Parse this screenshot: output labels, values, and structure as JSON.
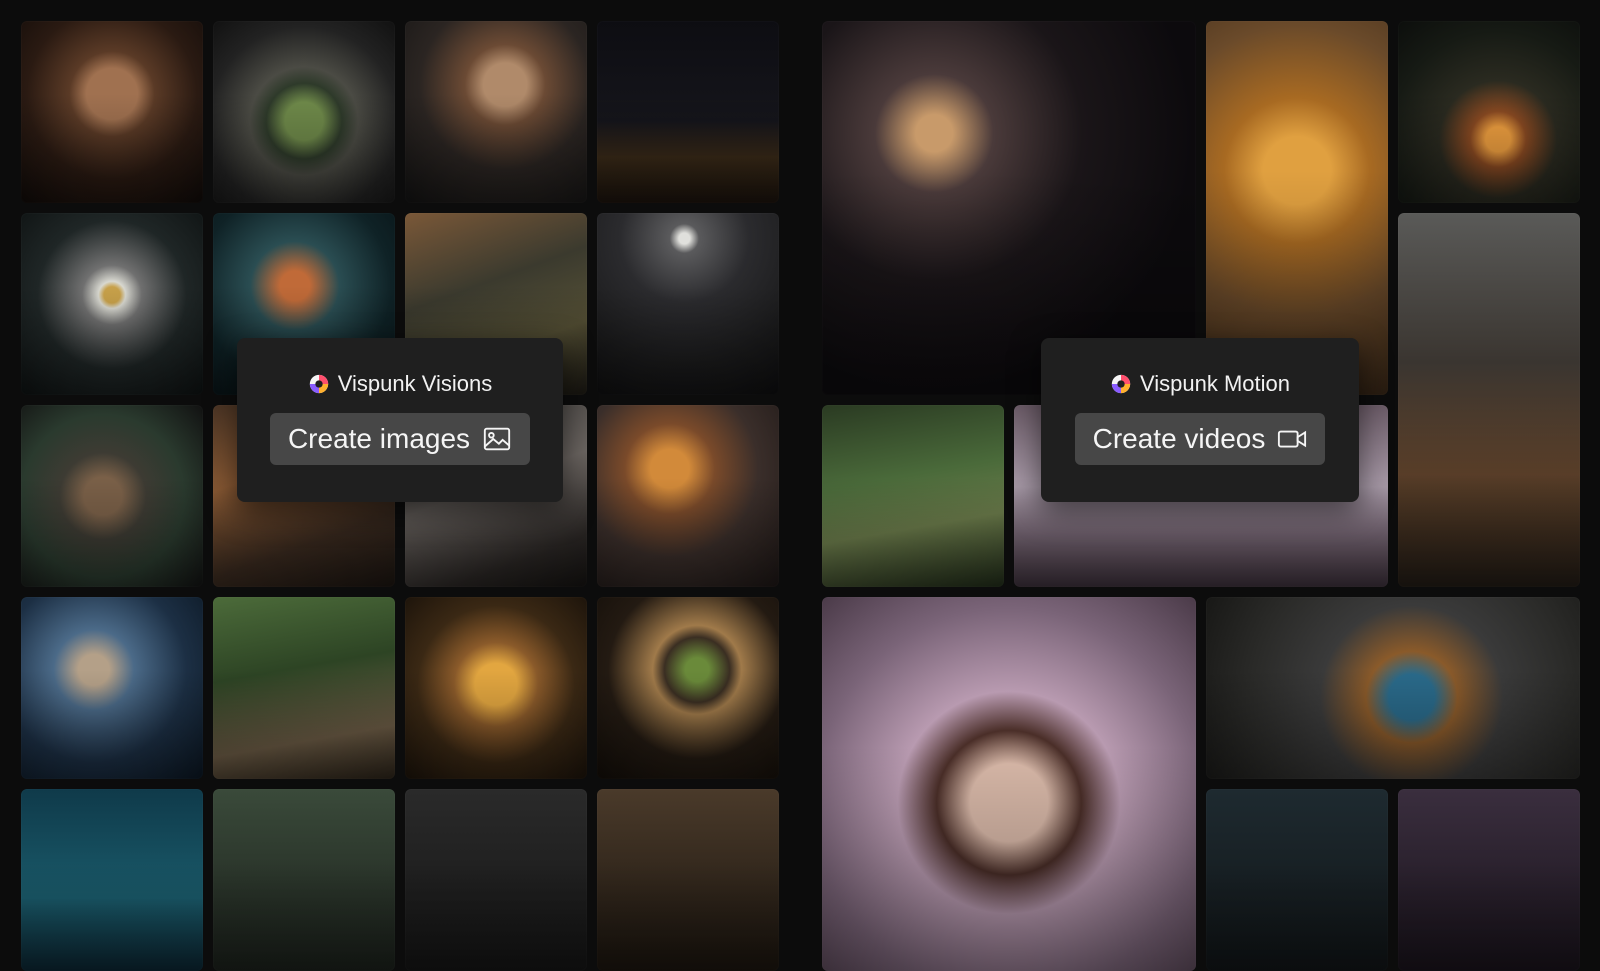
{
  "visions": {
    "brand_name": "Vispunk Visions",
    "cta_label": "Create images",
    "cta_icon": "image-icon"
  },
  "motion": {
    "brand_name": "Vispunk Motion",
    "cta_label": "Create videos",
    "cta_icon": "video-camera-icon"
  },
  "colors": {
    "page_background": "#0c0c0c",
    "card_background": "#1f1f1f",
    "button_background": "#474747",
    "text": "#f2f2f2"
  }
}
